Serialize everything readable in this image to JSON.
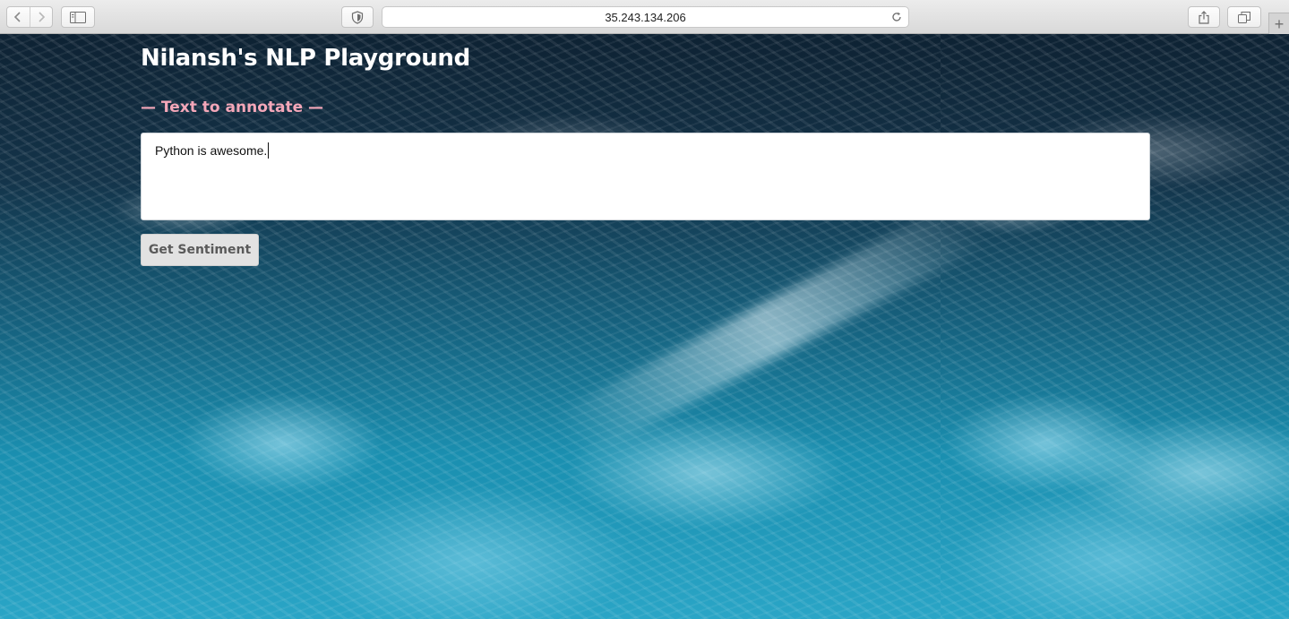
{
  "browser": {
    "address": "35.243.134.206",
    "new_tab_glyph": "+",
    "icons": {
      "back": "chevron-left-icon",
      "forward": "chevron-right-icon",
      "sidebar": "sidebar-icon",
      "privacy": "shield-icon",
      "reload": "reload-icon",
      "share": "share-icon",
      "tabs": "tabs-overview-icon"
    }
  },
  "page": {
    "title": "Nilansh's NLP Playground",
    "section_label": "— Text to annotate —",
    "textarea": {
      "value": "Python is awesome."
    },
    "submit_label": "Get Sentiment",
    "colors": {
      "title": "#ffffff",
      "section_label": "#f4a7b9",
      "button_bg": "#e2e2e2",
      "button_text": "#5a5a5a"
    }
  }
}
